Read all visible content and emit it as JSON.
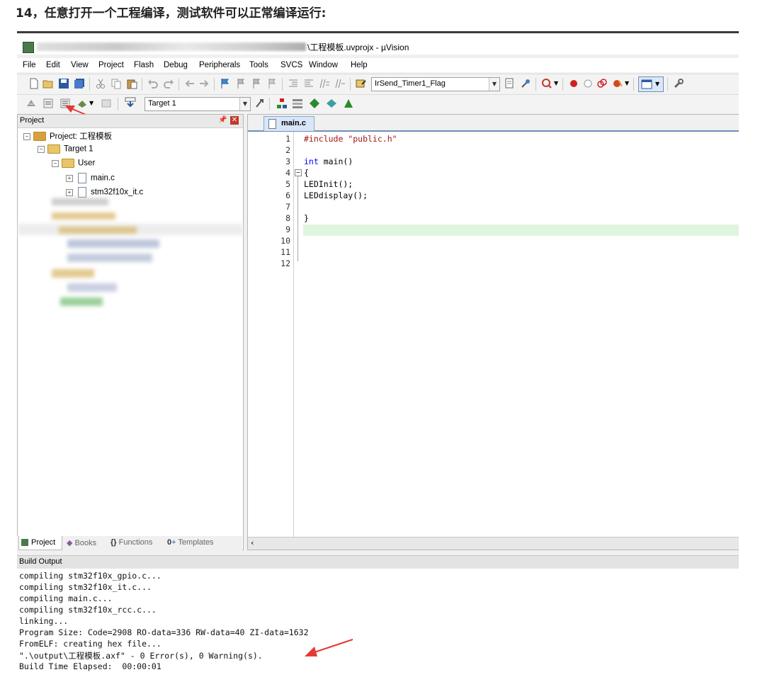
{
  "doc_heading": "14，任意打开一个工程编译，测试软件可以正常编译运行:",
  "window": {
    "title": "\\工程模板.uvprojx - µVision"
  },
  "menu": [
    "File",
    "Edit",
    "View",
    "Project",
    "Flash",
    "Debug",
    "Peripherals",
    "Tools",
    "SVCS",
    "Window",
    "Help"
  ],
  "toolbar": {
    "function_combo": "IrSend_Timer1_Flag",
    "target_combo": "Target 1"
  },
  "project_panel": {
    "title": "Project",
    "root": "Project: 工程模板",
    "target": "Target 1",
    "group": "User",
    "files": [
      "main.c",
      "stm32f10x_it.c"
    ],
    "tabs": [
      "Project",
      "Books",
      "Functions",
      "Templates"
    ]
  },
  "editor": {
    "tab": "main.c",
    "line_numbers": [
      "1",
      "2",
      "3",
      "4",
      "5",
      "6",
      "7",
      "8",
      "9",
      "10",
      "11",
      "12"
    ],
    "code": [
      "#include \"public.h\"",
      "",
      "int main()",
      "{",
      "LEDInit();",
      "LEDdisplay();",
      "",
      "}",
      "",
      "",
      "",
      ""
    ]
  },
  "build_output": {
    "title": "Build Output",
    "lines": [
      "compiling stm32f10x_gpio.c...",
      "compiling stm32f10x_it.c...",
      "compiling main.c...",
      "compiling stm32f10x_rcc.c...",
      "linking...",
      "Program Size: Code=2908 RO-data=336 RW-data=40 ZI-data=1632",
      "FromELF: creating hex file...",
      "\".\\output\\工程模板.axf\" - 0 Error(s), 0 Warning(s).",
      "Build Time Elapsed:  00:00:01"
    ]
  },
  "colors": {
    "annotation_arrow": "#e53935",
    "current_line": "#dff5df",
    "keyword": "#0000ff",
    "string": "#a31515"
  }
}
